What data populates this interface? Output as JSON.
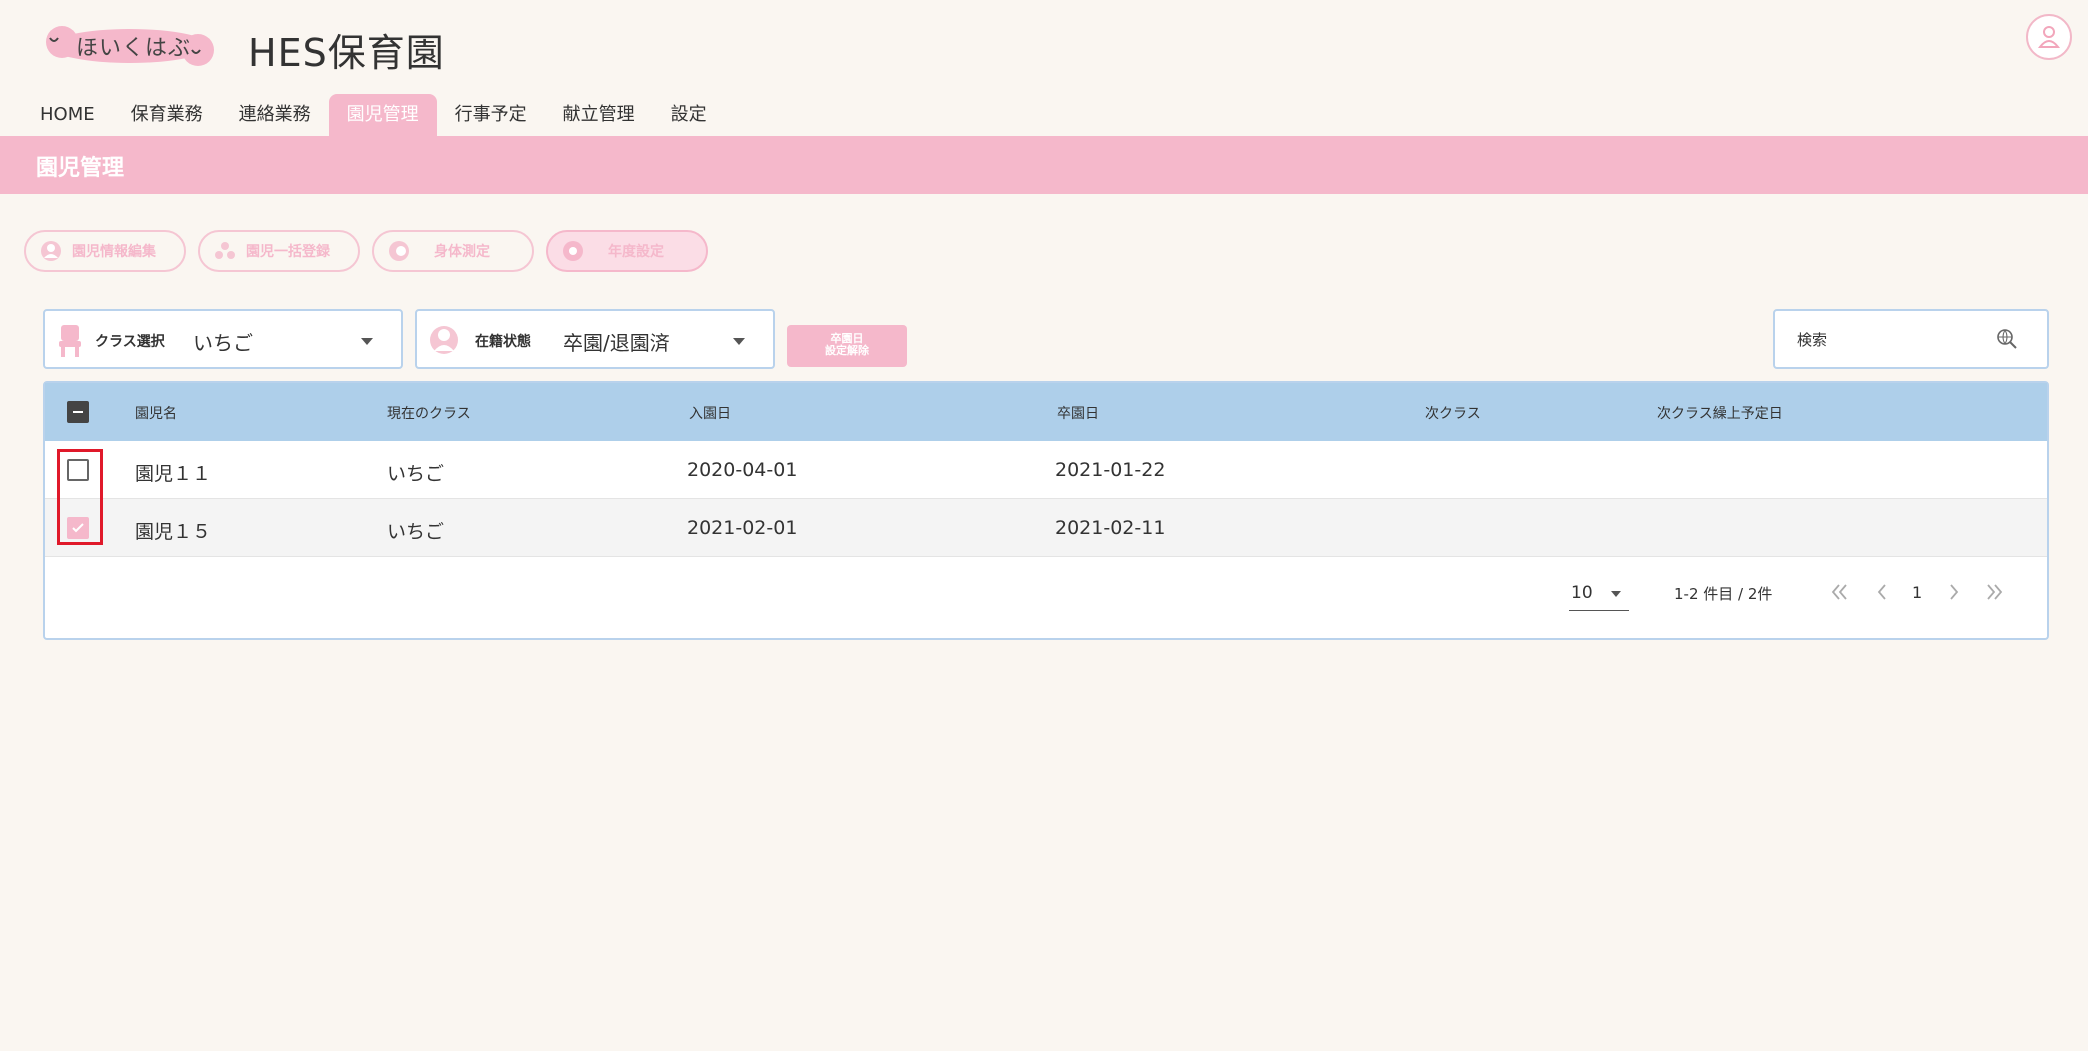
{
  "header": {
    "logo_text": "ほいくはぶ",
    "title": "HES保育園"
  },
  "nav": {
    "tabs": [
      {
        "label": "HOME"
      },
      {
        "label": "保育業務"
      },
      {
        "label": "連絡業務"
      },
      {
        "label": "園児管理",
        "active": true
      },
      {
        "label": "行事予定"
      },
      {
        "label": "献立管理"
      },
      {
        "label": "設定"
      }
    ]
  },
  "page": {
    "title": "園児管理"
  },
  "actions": {
    "edit_label": "園児情報編集",
    "bulk_label": "園児一括登録",
    "measure_label": "身体測定",
    "year_label": "年度設定"
  },
  "filters": {
    "class_label": "クラス選択",
    "class_value": "いちご",
    "status_label": "在籍状態",
    "status_value": "卒園/退園済",
    "grad_btn_line1": "卒園日",
    "grad_btn_line2": "設定解除",
    "search_placeholder": "検索"
  },
  "table": {
    "columns": [
      "園児名",
      "現在のクラス",
      "入園日",
      "卒園日",
      "次クラス",
      "次クラス繰上予定日"
    ],
    "rows": [
      {
        "name": "園児１１",
        "class": "いちご",
        "enroll": "2020-04-01",
        "graduate": "2021-01-22",
        "next_class": "",
        "next_date": "",
        "checked": false
      },
      {
        "name": "園児１５",
        "class": "いちご",
        "enroll": "2021-02-01",
        "graduate": "2021-02-11",
        "next_class": "",
        "next_date": "",
        "checked": true
      }
    ]
  },
  "pagination": {
    "page_size": "10",
    "range": "1-2 件目 / 2件",
    "current_page": "1"
  },
  "colors": {
    "accent_pink": "#f5b8cb",
    "header_blue": "#aecfea",
    "highlight_red": "#e0192a"
  }
}
